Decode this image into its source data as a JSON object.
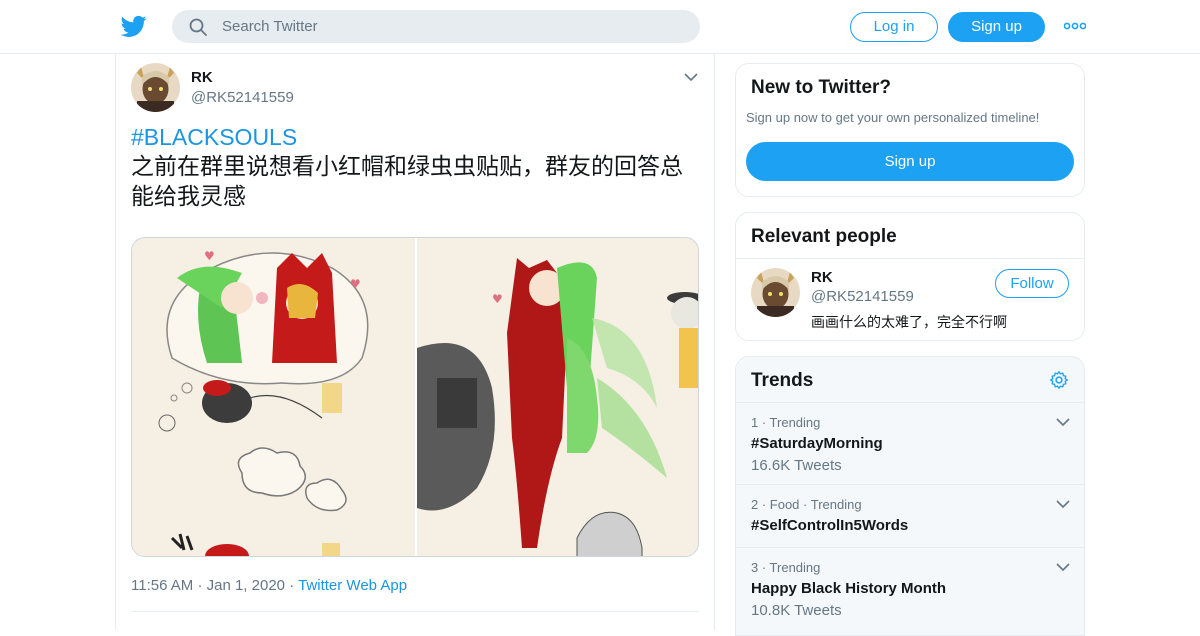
{
  "header": {
    "search_placeholder": "Search Twitter",
    "login_label": "Log in",
    "signup_label": "Sign up",
    "brand_color": "#1da1f2"
  },
  "tweet": {
    "author_name": "RK",
    "author_handle": "@RK52141559",
    "hashtag": "#BLACKSOULS",
    "text": "之前在群里说想看小红帽和绿虫虫贴贴，群友的回答总能给我灵感",
    "time": "11:56 AM",
    "date": "Jan 1, 2020",
    "source": "Twitter Web App"
  },
  "sidebar": {
    "new_to_twitter": {
      "title": "New to Twitter?",
      "subtitle": "Sign up now to get your own personalized timeline!",
      "button_label": "Sign up"
    },
    "relevant_people": {
      "title": "Relevant people",
      "name": "RK",
      "handle": "@RK52141559",
      "bio": "画画什么的太难了，完全不行啊",
      "follow_label": "Follow"
    },
    "trends": {
      "title": "Trends",
      "items": [
        {
          "context": "1 · Trending",
          "name": "#SaturdayMorning",
          "count": "16.6K Tweets"
        },
        {
          "context": "2 · Food · Trending",
          "name": "#SelfControlIn5Words",
          "count": ""
        },
        {
          "context": "3 · Trending",
          "name": "Happy Black History Month",
          "count": "10.8K Tweets"
        }
      ]
    }
  }
}
